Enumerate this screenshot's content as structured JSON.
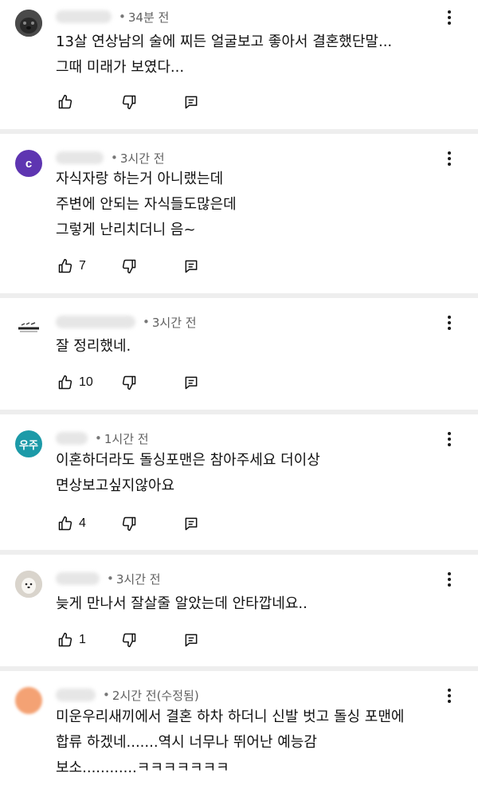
{
  "comments": [
    {
      "avatar_initials": "",
      "avatar_color": "#3b3b3b",
      "timestamp": "34분 전",
      "text": "13살 연상남의 술에 찌든 얼굴보고 좋아서 결혼했단말...\n그때 미래가 보였다...",
      "likes": ""
    },
    {
      "avatar_initials": "c",
      "avatar_color": "#5e35b1",
      "timestamp": "3시간 전",
      "text": "자식자랑 하는거 아니랬는데\n주변에 안되는 자식들도많은데\n 그렇게 난리치더니 음~",
      "likes": "7"
    },
    {
      "avatar_initials": "",
      "avatar_color": "#ffffff",
      "timestamp": "3시간 전",
      "text": "잘 정리했네.",
      "likes": "10"
    },
    {
      "avatar_initials": "우주",
      "avatar_color": "#1c9aa8",
      "timestamp": "1시간 전",
      "text": "이혼하더라도 돌싱포맨은 참아주세요 더이상\n면상보고싶지않아요",
      "likes": "4"
    },
    {
      "avatar_initials": "",
      "avatar_color": "#d9d4cc",
      "timestamp": "3시간 전",
      "text": "늦게 만나서 잘살줄 알았는데 안타깝네요..",
      "likes": "1"
    },
    {
      "avatar_initials": "",
      "avatar_color": "#f4a274",
      "timestamp": "2시간 전(수정됨)",
      "text": "미운우리새끼에서 결혼 하차 하더니 신발 벗고 돌싱 포맨에\n합류 하겠네.......역시 너무나 뛰어난 예능감\n보소............ㅋㅋㅋㅋㅋㅋㅋ",
      "likes": ""
    }
  ]
}
